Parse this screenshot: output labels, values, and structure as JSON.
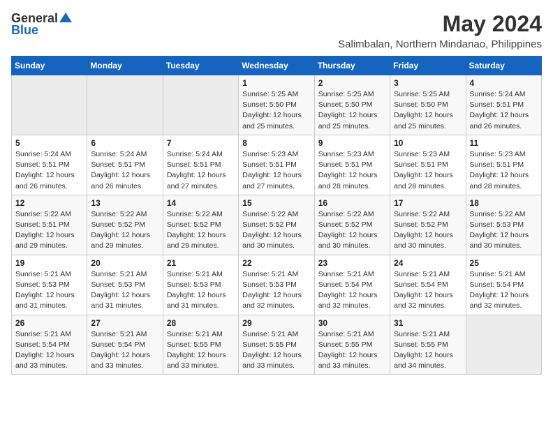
{
  "header": {
    "logo_general": "General",
    "logo_blue": "Blue",
    "month_year": "May 2024",
    "location": "Salimbalan, Northern Mindanao, Philippines"
  },
  "calendar": {
    "days_of_week": [
      "Sunday",
      "Monday",
      "Tuesday",
      "Wednesday",
      "Thursday",
      "Friday",
      "Saturday"
    ],
    "weeks": [
      [
        {
          "day": "",
          "info": ""
        },
        {
          "day": "",
          "info": ""
        },
        {
          "day": "",
          "info": ""
        },
        {
          "day": "1",
          "info": "Sunrise: 5:25 AM\nSunset: 5:50 PM\nDaylight: 12 hours\nand 25 minutes."
        },
        {
          "day": "2",
          "info": "Sunrise: 5:25 AM\nSunset: 5:50 PM\nDaylight: 12 hours\nand 25 minutes."
        },
        {
          "day": "3",
          "info": "Sunrise: 5:25 AM\nSunset: 5:50 PM\nDaylight: 12 hours\nand 25 minutes."
        },
        {
          "day": "4",
          "info": "Sunrise: 5:24 AM\nSunset: 5:51 PM\nDaylight: 12 hours\nand 26 minutes."
        }
      ],
      [
        {
          "day": "5",
          "info": "Sunrise: 5:24 AM\nSunset: 5:51 PM\nDaylight: 12 hours\nand 26 minutes."
        },
        {
          "day": "6",
          "info": "Sunrise: 5:24 AM\nSunset: 5:51 PM\nDaylight: 12 hours\nand 26 minutes."
        },
        {
          "day": "7",
          "info": "Sunrise: 5:24 AM\nSunset: 5:51 PM\nDaylight: 12 hours\nand 27 minutes."
        },
        {
          "day": "8",
          "info": "Sunrise: 5:23 AM\nSunset: 5:51 PM\nDaylight: 12 hours\nand 27 minutes."
        },
        {
          "day": "9",
          "info": "Sunrise: 5:23 AM\nSunset: 5:51 PM\nDaylight: 12 hours\nand 28 minutes."
        },
        {
          "day": "10",
          "info": "Sunrise: 5:23 AM\nSunset: 5:51 PM\nDaylight: 12 hours\nand 28 minutes."
        },
        {
          "day": "11",
          "info": "Sunrise: 5:23 AM\nSunset: 5:51 PM\nDaylight: 12 hours\nand 28 minutes."
        }
      ],
      [
        {
          "day": "12",
          "info": "Sunrise: 5:22 AM\nSunset: 5:51 PM\nDaylight: 12 hours\nand 29 minutes."
        },
        {
          "day": "13",
          "info": "Sunrise: 5:22 AM\nSunset: 5:52 PM\nDaylight: 12 hours\nand 29 minutes."
        },
        {
          "day": "14",
          "info": "Sunrise: 5:22 AM\nSunset: 5:52 PM\nDaylight: 12 hours\nand 29 minutes."
        },
        {
          "day": "15",
          "info": "Sunrise: 5:22 AM\nSunset: 5:52 PM\nDaylight: 12 hours\nand 30 minutes."
        },
        {
          "day": "16",
          "info": "Sunrise: 5:22 AM\nSunset: 5:52 PM\nDaylight: 12 hours\nand 30 minutes."
        },
        {
          "day": "17",
          "info": "Sunrise: 5:22 AM\nSunset: 5:52 PM\nDaylight: 12 hours\nand 30 minutes."
        },
        {
          "day": "18",
          "info": "Sunrise: 5:22 AM\nSunset: 5:53 PM\nDaylight: 12 hours\nand 30 minutes."
        }
      ],
      [
        {
          "day": "19",
          "info": "Sunrise: 5:21 AM\nSunset: 5:53 PM\nDaylight: 12 hours\nand 31 minutes."
        },
        {
          "day": "20",
          "info": "Sunrise: 5:21 AM\nSunset: 5:53 PM\nDaylight: 12 hours\nand 31 minutes."
        },
        {
          "day": "21",
          "info": "Sunrise: 5:21 AM\nSunset: 5:53 PM\nDaylight: 12 hours\nand 31 minutes."
        },
        {
          "day": "22",
          "info": "Sunrise: 5:21 AM\nSunset: 5:53 PM\nDaylight: 12 hours\nand 32 minutes."
        },
        {
          "day": "23",
          "info": "Sunrise: 5:21 AM\nSunset: 5:54 PM\nDaylight: 12 hours\nand 32 minutes."
        },
        {
          "day": "24",
          "info": "Sunrise: 5:21 AM\nSunset: 5:54 PM\nDaylight: 12 hours\nand 32 minutes."
        },
        {
          "day": "25",
          "info": "Sunrise: 5:21 AM\nSunset: 5:54 PM\nDaylight: 12 hours\nand 32 minutes."
        }
      ],
      [
        {
          "day": "26",
          "info": "Sunrise: 5:21 AM\nSunset: 5:54 PM\nDaylight: 12 hours\nand 33 minutes."
        },
        {
          "day": "27",
          "info": "Sunrise: 5:21 AM\nSunset: 5:54 PM\nDaylight: 12 hours\nand 33 minutes."
        },
        {
          "day": "28",
          "info": "Sunrise: 5:21 AM\nSunset: 5:55 PM\nDaylight: 12 hours\nand 33 minutes."
        },
        {
          "day": "29",
          "info": "Sunrise: 5:21 AM\nSunset: 5:55 PM\nDaylight: 12 hours\nand 33 minutes."
        },
        {
          "day": "30",
          "info": "Sunrise: 5:21 AM\nSunset: 5:55 PM\nDaylight: 12 hours\nand 33 minutes."
        },
        {
          "day": "31",
          "info": "Sunrise: 5:21 AM\nSunset: 5:55 PM\nDaylight: 12 hours\nand 34 minutes."
        },
        {
          "day": "",
          "info": ""
        }
      ]
    ]
  }
}
